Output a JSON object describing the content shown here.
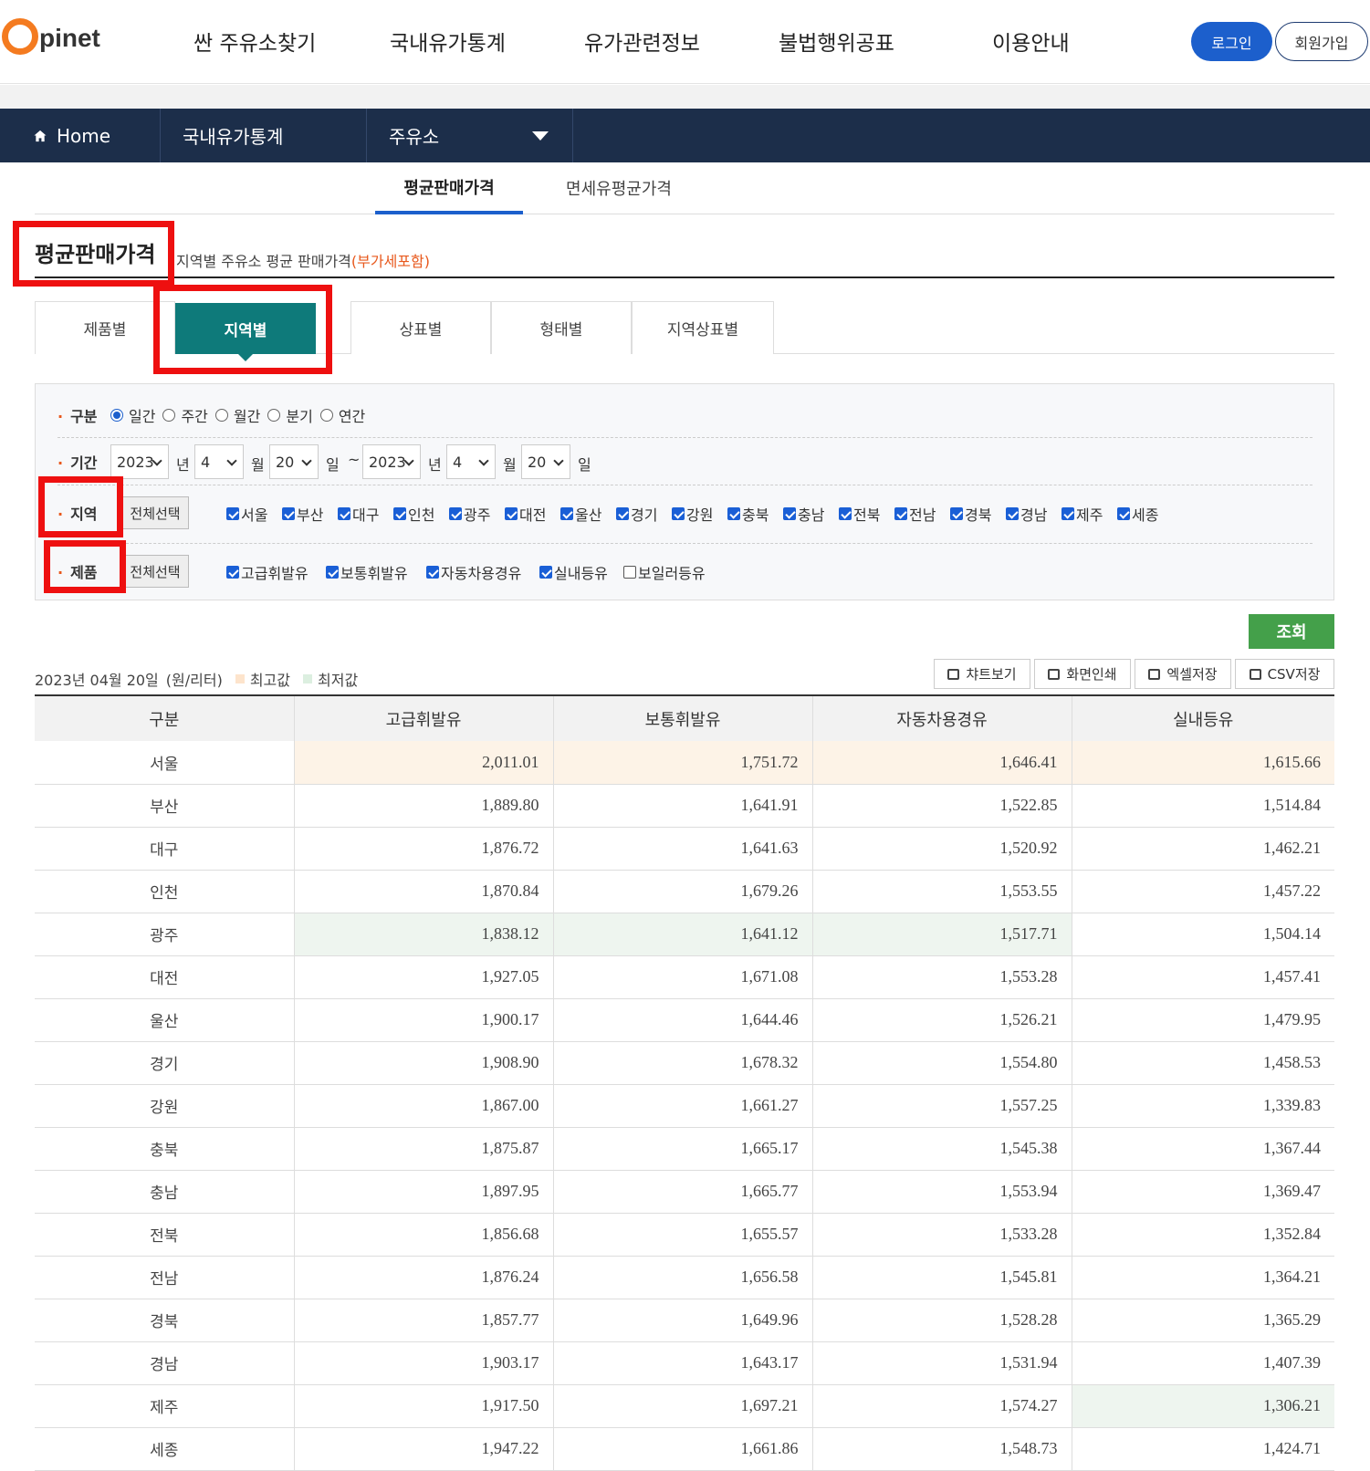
{
  "header": {
    "logo_text": "pinet",
    "gnb": [
      "싼 주유소찾기",
      "국내유가통계",
      "유가관련정보",
      "불법행위공표",
      "이용안내"
    ],
    "login": "로그인",
    "join": "회원가입"
  },
  "nav": {
    "home": "Home",
    "section": "국내유가통계",
    "current": "주유소"
  },
  "subtabs": [
    "평균판매가격",
    "면세유평균가격"
  ],
  "section": {
    "title": "평균판매가격",
    "desc": "지역별 주유소 평균 판매가격",
    "desc_red": "(부가세포함)"
  },
  "cattabs": [
    "제품별",
    "지역별",
    "상표별",
    "형태별",
    "지역상표별"
  ],
  "filter": {
    "type_label": "구분",
    "type_options": [
      "일간",
      "주간",
      "월간",
      "분기",
      "연간"
    ],
    "period_label": "기간",
    "from": {
      "year": "2023",
      "month": "4",
      "day": "20"
    },
    "to": {
      "year": "2023",
      "month": "4",
      "day": "20"
    },
    "unit_year": "년",
    "unit_month": "월",
    "unit_day": "일",
    "tilde": "~",
    "region_label": "지역",
    "select_all": "전체선택",
    "regions": [
      "서울",
      "부산",
      "대구",
      "인천",
      "광주",
      "대전",
      "울산",
      "경기",
      "강원",
      "충북",
      "충남",
      "전북",
      "전남",
      "경북",
      "경남",
      "제주",
      "세종"
    ],
    "product_label": "제품",
    "products": [
      "고급휘발유",
      "보통휘발유",
      "자동차용경유",
      "실내등유",
      "보일러등유"
    ],
    "products_checked": [
      true,
      true,
      true,
      true,
      false
    ]
  },
  "search_btn": "조회",
  "info": {
    "date": "2023년 04월 20일",
    "unit": "(원/리터)",
    "max": "최고값",
    "min": "최저값"
  },
  "tools": [
    "챠트보기",
    "화면인쇄",
    "엑셀저장",
    "CSV저장"
  ],
  "colors": {
    "max_bg": "#fdf3e7",
    "min_bg": "#eef5ef",
    "active_tab": "#0e7a7a",
    "nav_bg": "#1c2e4a"
  },
  "table": {
    "headers": [
      "구분",
      "고급휘발유",
      "보통휘발유",
      "자동차용경유",
      "실내등유"
    ],
    "rows": [
      [
        "서울",
        "2,011.01",
        "1,751.72",
        "1,646.41",
        "1,615.66"
      ],
      [
        "부산",
        "1,889.80",
        "1,641.91",
        "1,522.85",
        "1,514.84"
      ],
      [
        "대구",
        "1,876.72",
        "1,641.63",
        "1,520.92",
        "1,462.21"
      ],
      [
        "인천",
        "1,870.84",
        "1,679.26",
        "1,553.55",
        "1,457.22"
      ],
      [
        "광주",
        "1,838.12",
        "1,641.12",
        "1,517.71",
        "1,504.14"
      ],
      [
        "대전",
        "1,927.05",
        "1,671.08",
        "1,553.28",
        "1,457.41"
      ],
      [
        "울산",
        "1,900.17",
        "1,644.46",
        "1,526.21",
        "1,479.95"
      ],
      [
        "경기",
        "1,908.90",
        "1,678.32",
        "1,554.80",
        "1,458.53"
      ],
      [
        "강원",
        "1,867.00",
        "1,661.27",
        "1,557.25",
        "1,339.83"
      ],
      [
        "충북",
        "1,875.87",
        "1,665.17",
        "1,545.38",
        "1,367.44"
      ],
      [
        "충남",
        "1,897.95",
        "1,665.77",
        "1,553.94",
        "1,369.47"
      ],
      [
        "전북",
        "1,856.68",
        "1,655.57",
        "1,533.28",
        "1,352.84"
      ],
      [
        "전남",
        "1,876.24",
        "1,656.58",
        "1,545.81",
        "1,364.21"
      ],
      [
        "경북",
        "1,857.77",
        "1,649.96",
        "1,528.28",
        "1,365.29"
      ],
      [
        "경남",
        "1,903.17",
        "1,643.17",
        "1,531.94",
        "1,407.39"
      ],
      [
        "제주",
        "1,917.50",
        "1,697.21",
        "1,574.27",
        "1,306.21"
      ],
      [
        "세종",
        "1,947.22",
        "1,661.86",
        "1,548.73",
        "1,424.71"
      ]
    ],
    "highlights": {
      "max": [
        [
          0,
          1
        ],
        [
          0,
          2
        ],
        [
          0,
          3
        ],
        [
          0,
          4
        ]
      ],
      "min": [
        [
          4,
          1
        ],
        [
          4,
          2
        ],
        [
          4,
          3
        ],
        [
          15,
          4
        ]
      ]
    }
  }
}
